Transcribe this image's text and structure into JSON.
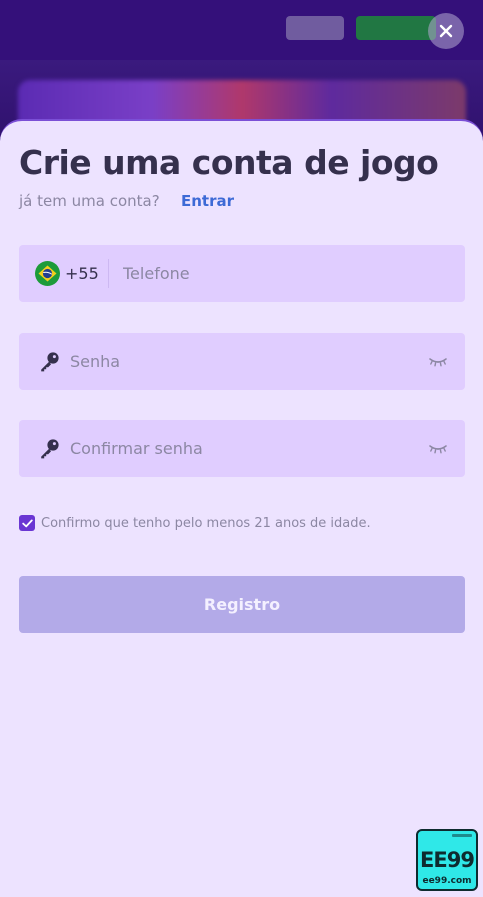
{
  "modal": {
    "title": "Crie uma conta de jogo",
    "subtitle": "já tem uma conta?",
    "login_link": "Entrar"
  },
  "phone": {
    "country_flag": "brazil-flag-icon",
    "dial_code": "+55",
    "placeholder": "Telefone",
    "value": ""
  },
  "password": {
    "placeholder": "Senha",
    "value": ""
  },
  "confirm_password": {
    "placeholder": "Confirmar senha",
    "value": ""
  },
  "age_confirm": {
    "checked": true,
    "label": "Confirmo que tenho pelo menos 21 anos de idade."
  },
  "register_button": {
    "label": "Registro",
    "enabled": false
  },
  "watermark": {
    "text": "EE99",
    "domain": "ee99.com"
  },
  "colors": {
    "sheet_background": "#ede3ff",
    "field_background": "#e0cdff",
    "accent": "#6a36d3",
    "link": "#3d6ad6",
    "button_disabled": "#b3aae8",
    "title_text": "#35304d"
  },
  "icons": {
    "close": "close-icon",
    "password_field": "key-icon",
    "visibility": "eye-closed-icon",
    "checkbox": "checkmark-icon"
  }
}
